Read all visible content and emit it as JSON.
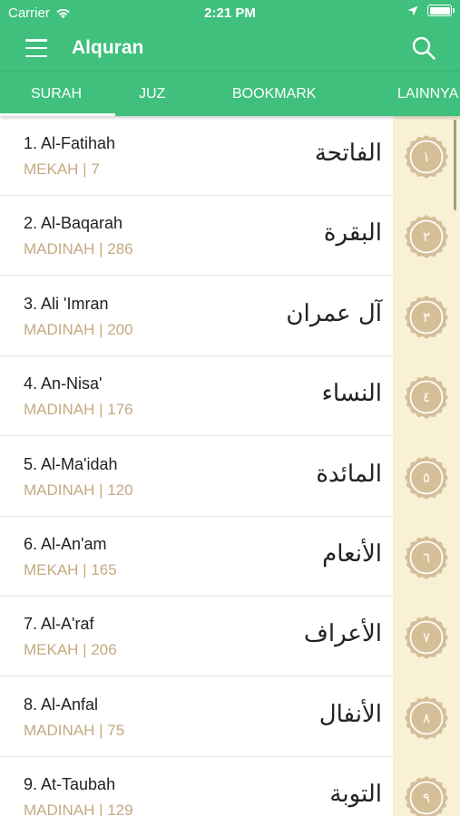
{
  "status_bar": {
    "carrier": "Carrier",
    "time": "2:21 PM",
    "icons": [
      "wifi-icon",
      "location-arrow-icon",
      "battery-icon"
    ]
  },
  "app_bar": {
    "title": "Alquran",
    "menu_icon": "hamburger-menu-icon",
    "search_icon": "search-icon"
  },
  "tabs": [
    {
      "label": "SURAH",
      "active": true
    },
    {
      "label": "JUZ",
      "active": false
    },
    {
      "label": "BOOKMARK",
      "active": false
    },
    {
      "label": "LAINNYA",
      "active": false
    }
  ],
  "colors": {
    "primary": "#3fc07c",
    "meta_text": "#c4aa82",
    "side_strip": "#f8f1d6",
    "badge": "#d5bf98"
  },
  "surahs": [
    {
      "name": "1. Al-Fatihah",
      "meta": "MEKAH | 7",
      "arabic": "الفاتحة",
      "number": "١"
    },
    {
      "name": "2. Al-Baqarah",
      "meta": "MADINAH | 286",
      "arabic": "البقرة",
      "number": "٢"
    },
    {
      "name": "3. Ali 'Imran",
      "meta": "MADINAH | 200",
      "arabic": "آل عمران",
      "number": "٣"
    },
    {
      "name": "4. An-Nisa'",
      "meta": "MADINAH | 176",
      "arabic": "النساء",
      "number": "٤"
    },
    {
      "name": "5. Al-Ma'idah",
      "meta": "MADINAH | 120",
      "arabic": "المائدة",
      "number": "٥"
    },
    {
      "name": "6. Al-An'am",
      "meta": "MEKAH | 165",
      "arabic": "الأنعام",
      "number": "٦"
    },
    {
      "name": "7. Al-A'raf",
      "meta": "MEKAH | 206",
      "arabic": "الأعراف",
      "number": "٧"
    },
    {
      "name": "8. Al-Anfal",
      "meta": "MADINAH | 75",
      "arabic": "الأنفال",
      "number": "٨"
    },
    {
      "name": "9. At-Taubah",
      "meta": "MADINAH | 129",
      "arabic": "التوبة",
      "number": "٩"
    }
  ]
}
